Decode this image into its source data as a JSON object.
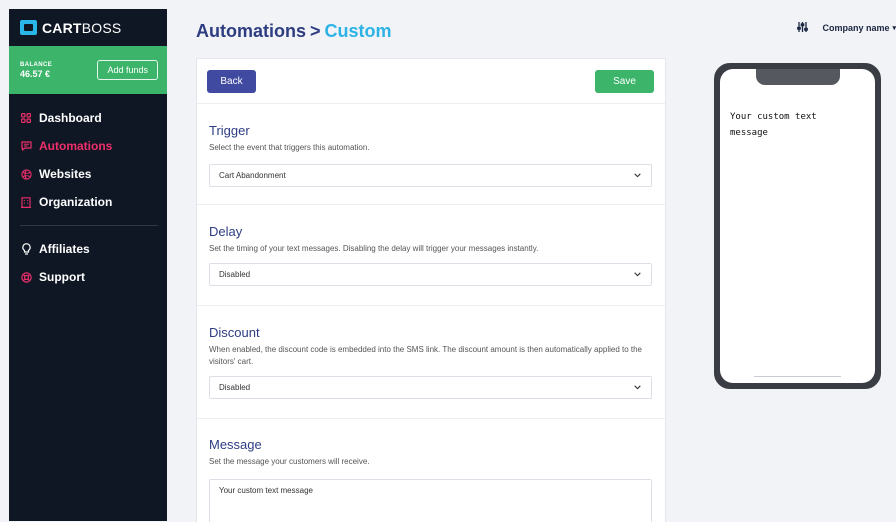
{
  "sidebar": {
    "logo": {
      "brand_bold": "CART",
      "brand_light": "BOSS"
    },
    "balance": {
      "label": "BALANCE",
      "value": "46.57 €",
      "add_funds_label": "Add funds"
    },
    "items": [
      {
        "label": "Dashboard",
        "icon": "grid-icon",
        "active": false
      },
      {
        "label": "Automations",
        "icon": "message-icon",
        "active": true
      },
      {
        "label": "Websites",
        "icon": "globe-icon",
        "active": false
      },
      {
        "label": "Organization",
        "icon": "building-icon",
        "active": false
      }
    ],
    "secondary_items": [
      {
        "label": "Affiliates",
        "icon": "lightbulb-icon"
      },
      {
        "label": "Support",
        "icon": "lifebuoy-icon"
      }
    ]
  },
  "header": {
    "breadcrumb_parent": "Automations",
    "breadcrumb_separator": ">",
    "breadcrumb_current": "Custom",
    "company_name": "Company name"
  },
  "actions": {
    "back_label": "Back",
    "save_label": "Save"
  },
  "trigger": {
    "title": "Trigger",
    "description": "Select the event that triggers this automation.",
    "selected": "Cart Abandonment"
  },
  "delay": {
    "title": "Delay",
    "description": "Set the timing of your text messages. Disabling the delay will trigger your messages instantly.",
    "selected": "Disabled"
  },
  "discount": {
    "title": "Discount",
    "description": "When enabled, the discount code is embedded into the SMS link. The discount amount is then automatically applied to the visitors' cart.",
    "selected": "Disabled"
  },
  "message": {
    "title": "Message",
    "description": "Set the message your customers will receive.",
    "value": "Your custom text message"
  },
  "preview": {
    "sms_text": "Your custom text message"
  },
  "colors": {
    "sidebar_bg": "#0f1724",
    "balance_bg": "#3cb56b",
    "active_nav": "#ee2f6b",
    "title_primary": "#2e3d82",
    "title_accent": "#2cb3e6",
    "back_button": "#3f4aa0",
    "save_button": "#3cb56b"
  }
}
